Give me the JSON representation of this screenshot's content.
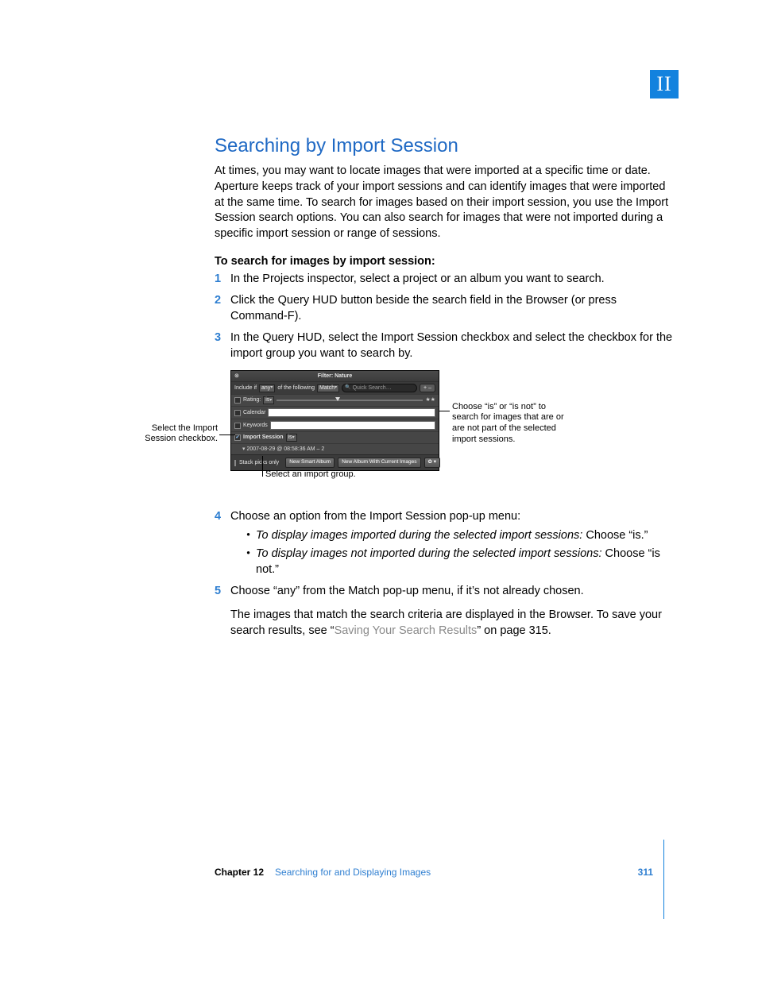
{
  "part_label": "II",
  "heading": "Searching by Import Session",
  "intro": "At times, you may want to locate images that were imported at a specific time or date. Aperture keeps track of your import sessions and can identify images that were imported at the same time. To search for images based on their import session, you use the Import Session search options. You can also search for images that were not imported during a specific import session or range of sessions.",
  "task_heading": "To search for images by import session:",
  "steps": {
    "s1": "In the Projects inspector, select a project or an album you want to search.",
    "s2": "Click the Query HUD button beside the search field in the Browser (or press Command-F).",
    "s3": "In the Query HUD, select the Import Session checkbox and select the checkbox for the import group you want to search by.",
    "s4": "Choose an option from the Import Session pop-up menu:",
    "s4_b1_i": "To display images imported during the selected import sessions:",
    "s4_b1_r": "  Choose “is.”",
    "s4_b2_i": "To display images not imported during the selected import sessions:",
    "s4_b2_r": "  Choose “is not.”",
    "s5": "Choose “any” from the Match pop-up menu, if it’s not already chosen."
  },
  "result": {
    "before": "The images that match the search criteria are displayed in the Browser. To save your search results, see “",
    "link": "Saving Your Search Results",
    "after": "” on page 315."
  },
  "hud": {
    "title": "Filter: Nature",
    "include_if": "Include if",
    "any": "any",
    "of_following": "of the following",
    "match": "Match",
    "quick_search": "Quick Search…",
    "plus_minus": "+ –",
    "rating": "Rating:",
    "rating_sel": "is",
    "stars": "★★",
    "calendar": "Calendar",
    "keywords": "Keywords",
    "import_session": "Import Session",
    "import_sel": "is",
    "import_group": "2007-08-29 @ 08:58:36 AM – 2",
    "stack_picks": "Stack picks only",
    "btn_smart": "New Smart Album",
    "btn_album": "New Album With Current Images",
    "gear": "✿ ▾"
  },
  "callouts": {
    "left": "Select the Import Session checkbox.",
    "right": "Choose “is” or “is not” to search for images that are or are not part of the selected import sessions.",
    "bottom": "Select an import group."
  },
  "footer": {
    "chapter_number": "Chapter 12",
    "chapter_name": "Searching for and Displaying Images",
    "page_number": "311"
  }
}
